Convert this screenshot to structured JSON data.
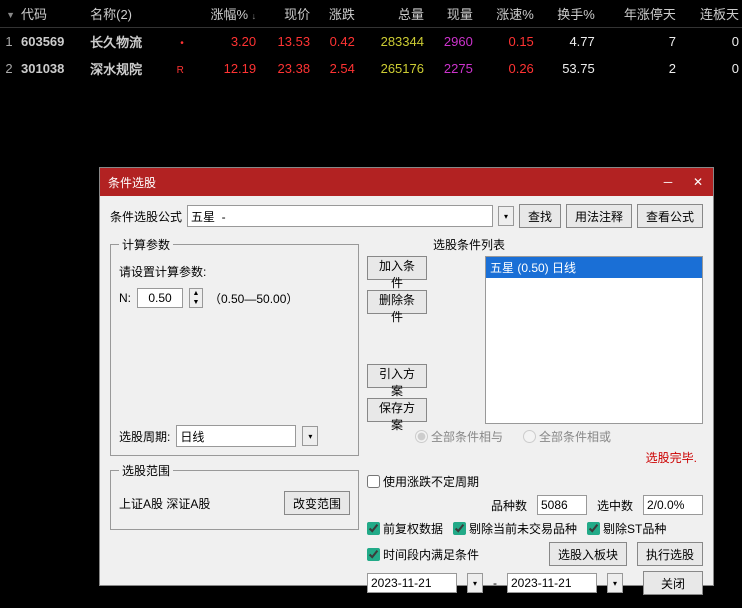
{
  "table": {
    "headers": [
      "",
      "代码",
      "名称(2)",
      "",
      "涨幅%",
      "现价",
      "涨跌",
      "总量",
      "现量",
      "涨速%",
      "换手%",
      "年涨停天",
      "连板天"
    ],
    "rows": [
      {
        "idx": "1",
        "code": "603569",
        "name": "长久物流",
        "flag": "•",
        "pct": "3.20",
        "price": "13.53",
        "chg": "0.42",
        "vol": "283344",
        "cur": "2960",
        "speed": "0.15",
        "turn": "4.77",
        "yup": "7",
        "streak": "0"
      },
      {
        "idx": "2",
        "code": "301038",
        "name": "深水规院",
        "flag": "R",
        "pct": "12.19",
        "price": "23.38",
        "chg": "2.54",
        "vol": "265176",
        "cur": "2275",
        "speed": "0.26",
        "turn": "53.75",
        "yup": "2",
        "streak": "0"
      }
    ]
  },
  "dialog": {
    "title": "条件选股",
    "formula_label": "条件选股公式",
    "formula_value": "五星  -",
    "find_btn": "查找",
    "usage_btn": "用法注释",
    "view_formula_btn": "查看公式",
    "calc_legend": "计算参数",
    "calc_hint": "请设置计算参数:",
    "param_name": "N:",
    "param_value": "0.50",
    "param_range": "（0.50—50.00）",
    "period_label": "选股周期:",
    "period_value": "日线",
    "scope_legend": "选股范围",
    "scope_text": "上证A股 深证A股",
    "scope_btn": "改变范围",
    "add_cond_btn": "加入条件",
    "del_cond_btn": "删除条件",
    "import_btn": "引入方案",
    "save_btn": "保存方案",
    "cond_list_label": "选股条件列表",
    "cond_item": "五星 (0.50) 日线",
    "radio_and": "全部条件相与",
    "radio_or": "全部条件相或",
    "status": "选股完毕.",
    "use_undef_period": "使用涨跌不定周期",
    "variety_label": "品种数",
    "variety_val": "5086",
    "selected_label": "选中数",
    "selected_val": "2/0.0%",
    "fq_chk": "前复权数据",
    "rm_nontrade": "剔除当前未交易品种",
    "rm_st": "剔除ST品种",
    "time_range_chk": "时间段内满足条件",
    "to_block_btn": "选股入板块",
    "exec_btn": "执行选股",
    "date1": "2023-11-21",
    "date2": "2023-11-21",
    "dash": "-",
    "close_btn": "关闭"
  }
}
